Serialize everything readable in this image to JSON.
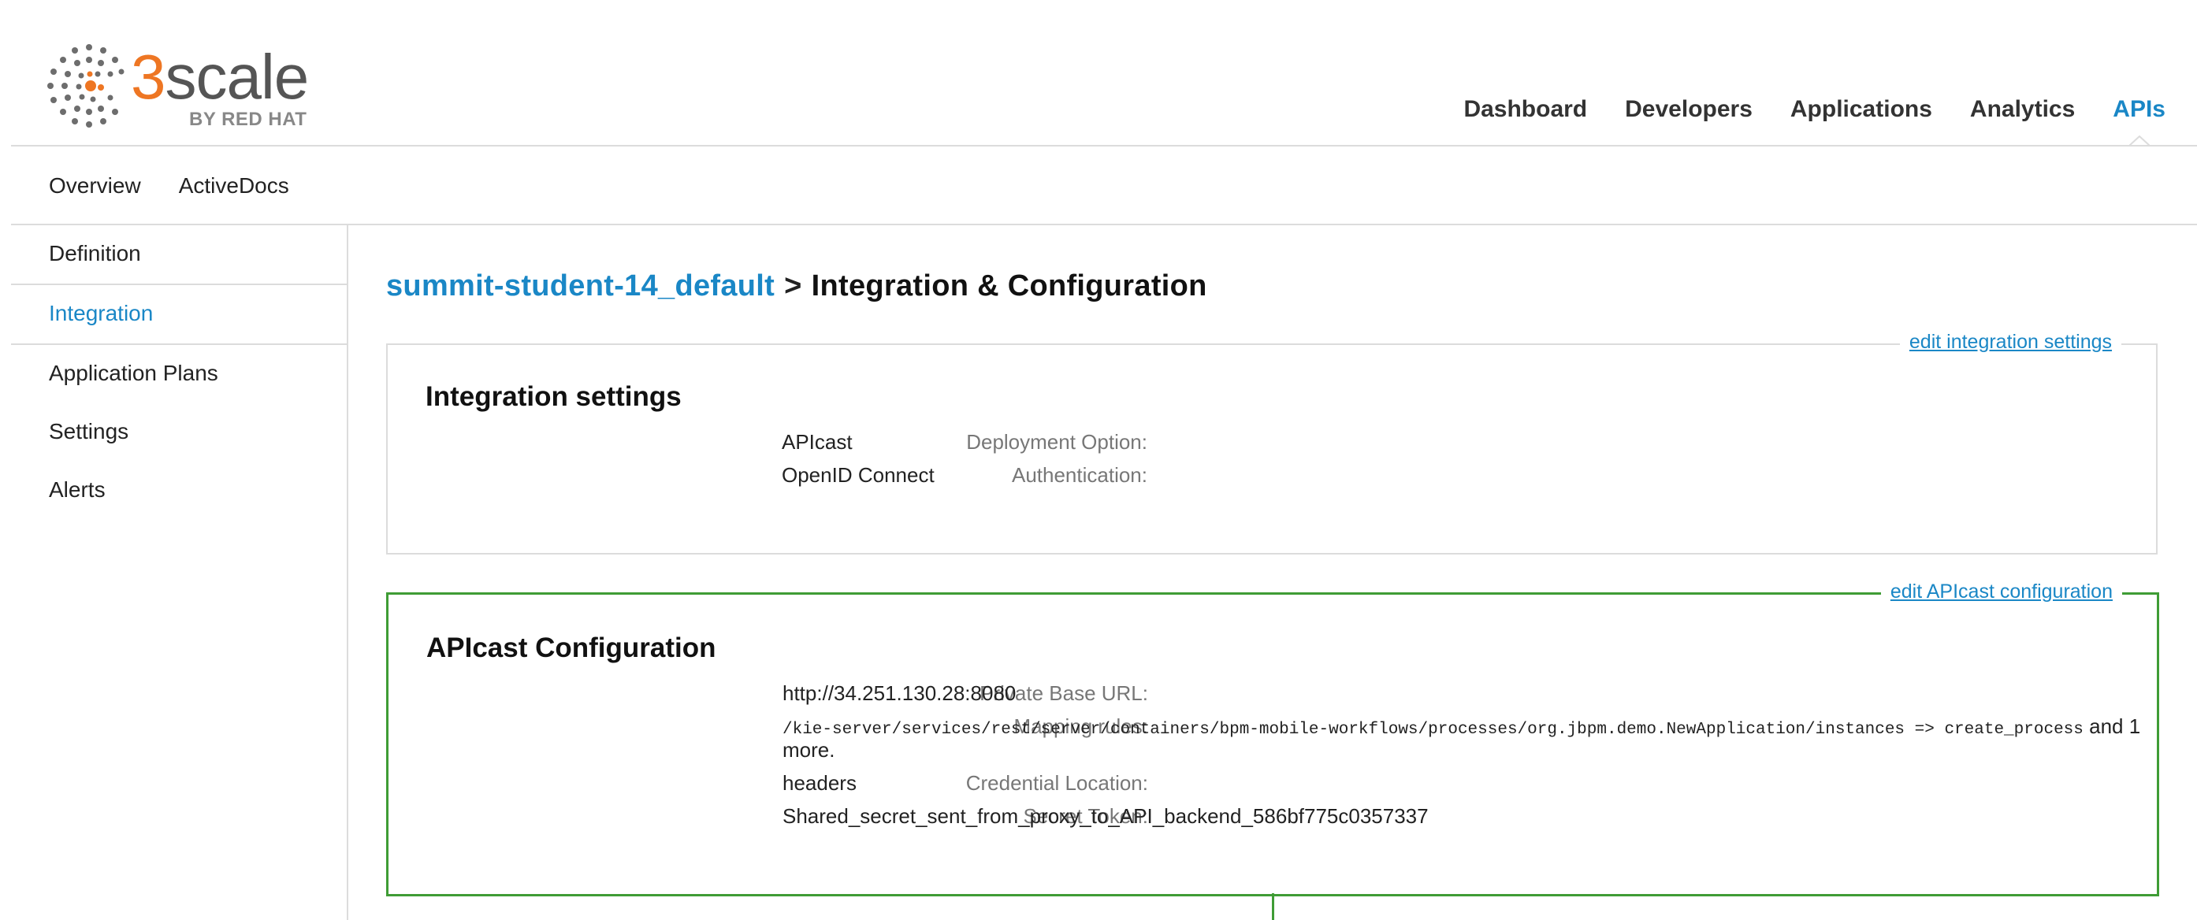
{
  "logo": {
    "name": "3scale",
    "tagline": "BY RED HAT"
  },
  "topnav": {
    "items": [
      "Dashboard",
      "Developers",
      "Applications",
      "Analytics",
      "APIs"
    ],
    "active": "APIs"
  },
  "subnav": {
    "items": [
      "Overview",
      "ActiveDocs"
    ]
  },
  "sidebar": {
    "items": [
      "Definition",
      "Integration",
      "Application Plans",
      "Settings",
      "Alerts"
    ],
    "active": "Integration"
  },
  "page": {
    "breadcrumb": "summit-student-14_default",
    "separator": ">",
    "title": "Integration & Configuration"
  },
  "integration_panel": {
    "edit_link": "edit integration settings",
    "title": "Integration settings",
    "rows": [
      {
        "label": "Deployment Option:",
        "value": "APIcast"
      },
      {
        "label": "Authentication:",
        "value": "OpenID Connect"
      }
    ]
  },
  "apicast_panel": {
    "edit_link": "edit APIcast configuration",
    "title": "APIcast Configuration",
    "private_base_url": {
      "label": "Private Base URL:",
      "value": "http://34.251.130.28:8080"
    },
    "mapping_rules": {
      "label": "Mapping rules:",
      "rule": "/kie-server/services/rest/server/containers/bpm-mobile-workflows/processes/org.jbpm.demo.NewApplication/instances => create_process",
      "suffix": "and 1",
      "suffix_line2": "more."
    },
    "credential_location": {
      "label": "Credential Location:",
      "value": "headers"
    },
    "secret_token": {
      "label": "Secret Token:",
      "value": "Shared_secret_sent_from_proxy_to_API_backend_586bf775c0357337"
    }
  },
  "colors": {
    "link_blue": "#1a87c6",
    "brand_orange": "#ee7623",
    "panel_green": "#3f9c35",
    "border_grey": "#dcdcdc"
  }
}
